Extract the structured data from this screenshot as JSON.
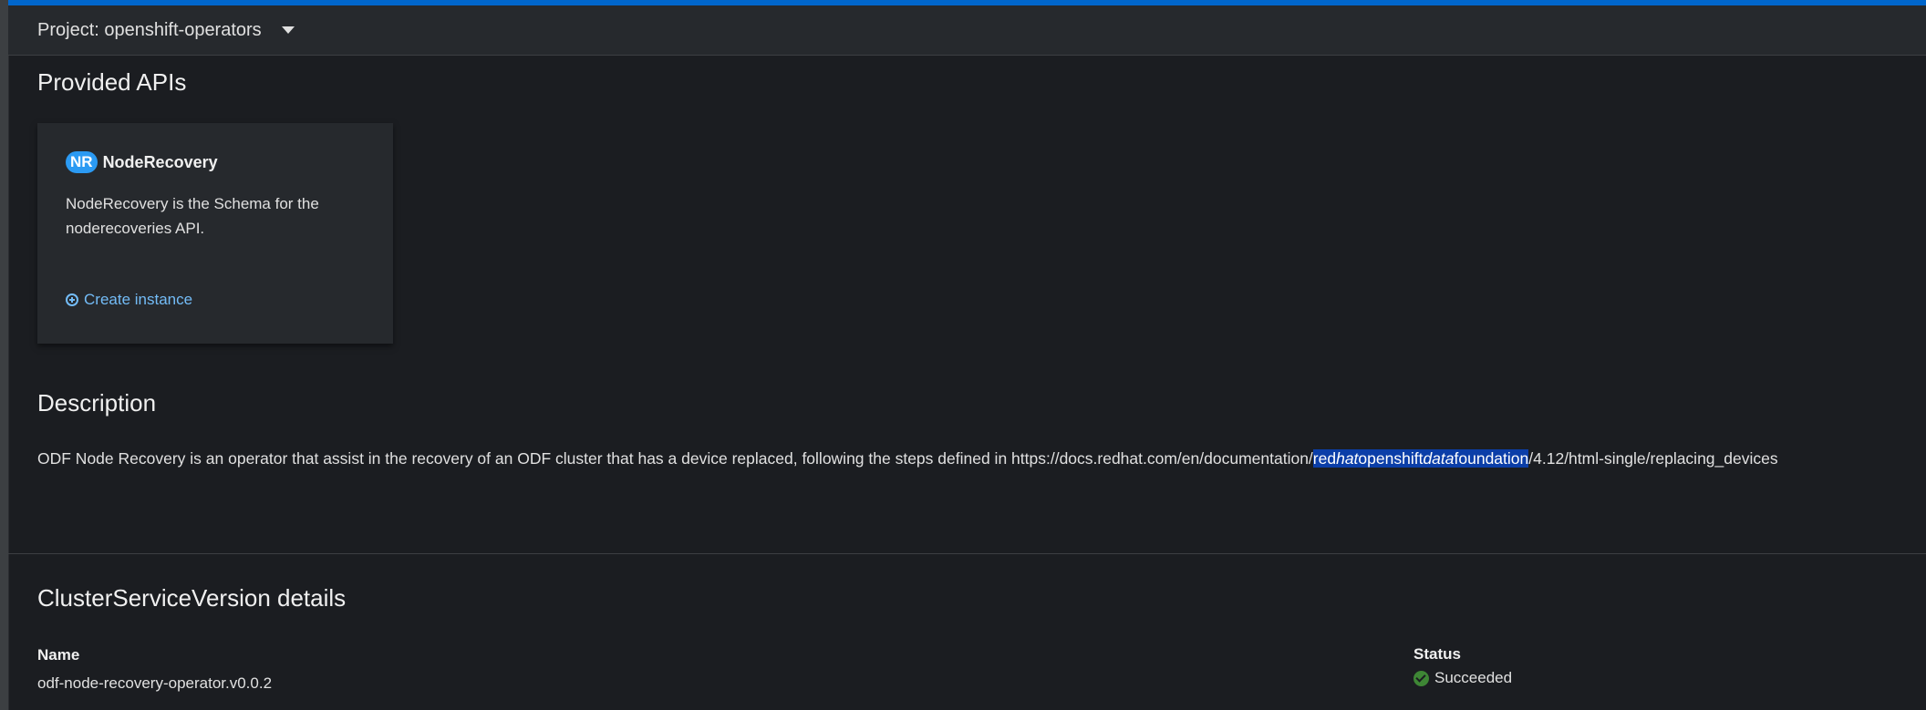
{
  "project_bar": {
    "label": "Project: openshift-operators"
  },
  "provided_apis": {
    "heading": "Provided APIs",
    "card": {
      "badge": "NR",
      "title": "NodeRecovery",
      "description": "NodeRecovery is the Schema for the noderecoveries API.",
      "create_label": "Create instance"
    }
  },
  "description": {
    "heading": "Description",
    "text_before": "ODF Node Recovery is an operator that assist in the recovery of an ODF cluster that has a device replaced, following the steps defined in https://docs.redhat.com/en/documentation/",
    "highlight_1": "red",
    "highlight_2": "hat",
    "highlight_3": "openshift",
    "highlight_4": "data",
    "highlight_5": "foundation",
    "text_after": "/4.12/html-single/replacing_devices"
  },
  "csv_details": {
    "heading": "ClusterServiceVersion details",
    "name_label": "Name",
    "name_value": "odf-node-recovery-operator.v0.0.2",
    "status_label": "Status",
    "status_value": "Succeeded"
  },
  "colors": {
    "accent": "#0066cc",
    "link": "#73bcf7",
    "badge": "#2b9af3",
    "success": "#3e8635",
    "selection": "#0b3ea8"
  }
}
